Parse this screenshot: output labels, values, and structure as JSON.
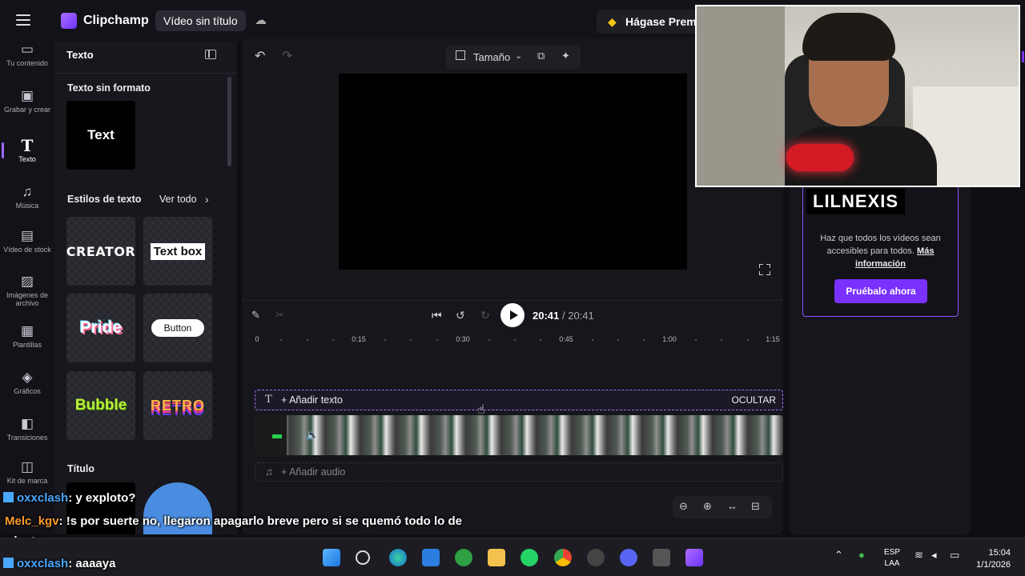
{
  "app": {
    "name": "Clipchamp",
    "project_title": "Vídeo sin título",
    "premium_label": "Hágase Premium"
  },
  "nav": [
    {
      "label": "Tu contenido",
      "icon": "folder-icon"
    },
    {
      "label": "Grabar y crear",
      "icon": "camera-icon"
    },
    {
      "label": "Texto",
      "icon": "text-icon",
      "active": true
    },
    {
      "label": "Música",
      "icon": "music-icon"
    },
    {
      "label": "Vídeo de stock",
      "icon": "film-icon"
    },
    {
      "label": "Imágenes de archivo",
      "icon": "image-icon"
    },
    {
      "label": "Plantillas",
      "icon": "template-icon"
    },
    {
      "label": "Gráficos",
      "icon": "shapes-icon"
    },
    {
      "label": "Transiciones",
      "icon": "transition-icon"
    },
    {
      "label": "Kit de marca",
      "icon": "brand-kit-icon"
    }
  ],
  "text_panel": {
    "title": "Texto",
    "plain_section": "Texto sin formato",
    "plain_sample": "Text",
    "styles_section": "Estilos de texto",
    "see_all": "Ver todo",
    "styles": [
      "CREATOR",
      "Text box",
      "Pride",
      "Button",
      "Bubble",
      "RETRO"
    ],
    "title_section": "Título"
  },
  "toolbar": {
    "size_label": "Tamaño"
  },
  "playback": {
    "current": "20:41",
    "total": "/ 20:41"
  },
  "ruler": [
    "0",
    "0:15",
    "0:30",
    "0:45",
    "1:00",
    "1:15"
  ],
  "timeline": {
    "add_text": "+ Añadir texto",
    "hide": "OCULTAR",
    "add_audio": "+ Añadir audio"
  },
  "promo": {
    "text": "Haz que todos los vídeos sean accesibles para todos.",
    "link": "Más información",
    "button": "Pruébalo ahora"
  },
  "overlay": {
    "streamer_name": "LILNEXIS"
  },
  "chat": [
    {
      "user": "oxxclash",
      "message": ": y exploto?"
    },
    {
      "user": "Melc_kgv",
      "message": ": !s por suerte no, llegaron apagarlo breve pero si se quemó todo lo de"
    },
    {
      "user": "",
      "message": "adentro"
    },
    {
      "user": "oxxclash",
      "message": ": aaaaya"
    }
  ],
  "taskbar": {
    "lang_top": "ESP",
    "lang_bottom": "LAA",
    "time": "15:04",
    "date": "1/1/2026"
  },
  "colors": {
    "accent": "#7a31ff",
    "chat_user_blue": "#4aa8ff",
    "chat_user_orange": "#ff9b2b"
  }
}
